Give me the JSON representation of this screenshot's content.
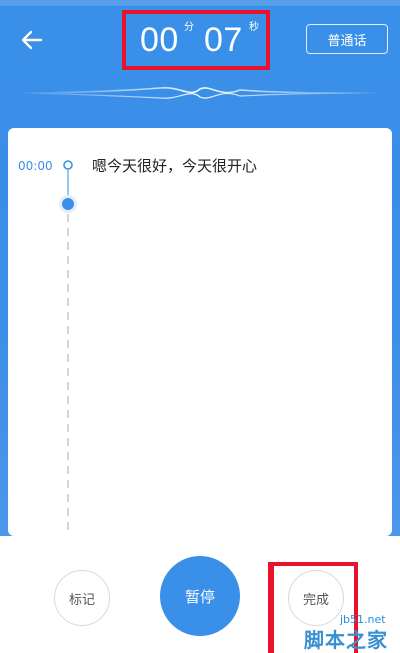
{
  "header": {
    "timer": {
      "minutes": "00",
      "minutes_unit": "分",
      "seconds": "07",
      "seconds_unit": "秒"
    },
    "language_label": "普通话",
    "accent_color": "#3a8fe8"
  },
  "transcript": {
    "entries": [
      {
        "time": "00:00",
        "text": "嗯今天很好，今天很开心"
      }
    ]
  },
  "controls": {
    "mark_label": "标记",
    "pause_label": "暂停",
    "done_label": "完成"
  },
  "watermark": {
    "url": "jb51.net",
    "name": "脚本之家"
  },
  "icons": {
    "back": "arrow-left-icon"
  },
  "colors": {
    "primary": "#3a8fe8",
    "highlight": "#e8132a"
  }
}
